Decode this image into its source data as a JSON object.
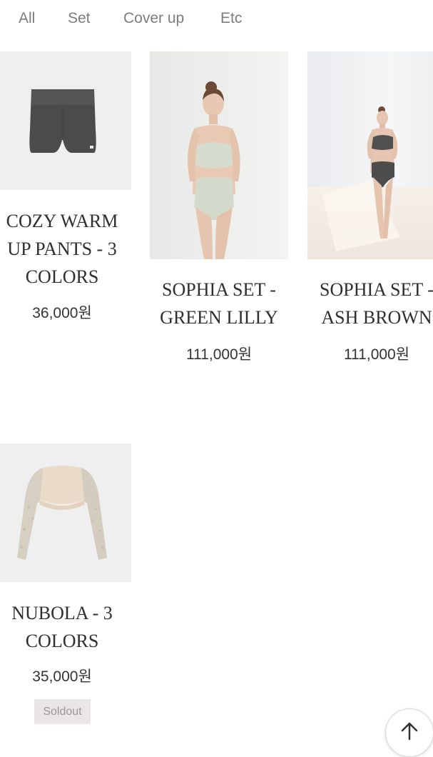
{
  "categories": [
    {
      "label": "All"
    },
    {
      "label": "Set"
    },
    {
      "label": "Cover up"
    },
    {
      "label": "Etc"
    }
  ],
  "products": [
    {
      "name": "COZY WARM\nUP PANTS - 3\nCOLORS",
      "price": "36,000원"
    },
    {
      "name": "SOPHIA SET -\nGREEN LILLY",
      "price": "111,000원"
    },
    {
      "name": "SOPHIA SET -\nASH BROWN",
      "price": "111,000원"
    },
    {
      "name": "NUBOLA - 3\nCOLORS",
      "price": "35,000원",
      "badge": "Soldout"
    }
  ],
  "icons": {
    "scroll_top": "arrow-up-icon"
  },
  "colors": {
    "tab_text": "#7c7c7c",
    "name_text": "#2f2f2f",
    "soldout_bg": "#eae6e8",
    "soldout_text": "#9a9698"
  }
}
